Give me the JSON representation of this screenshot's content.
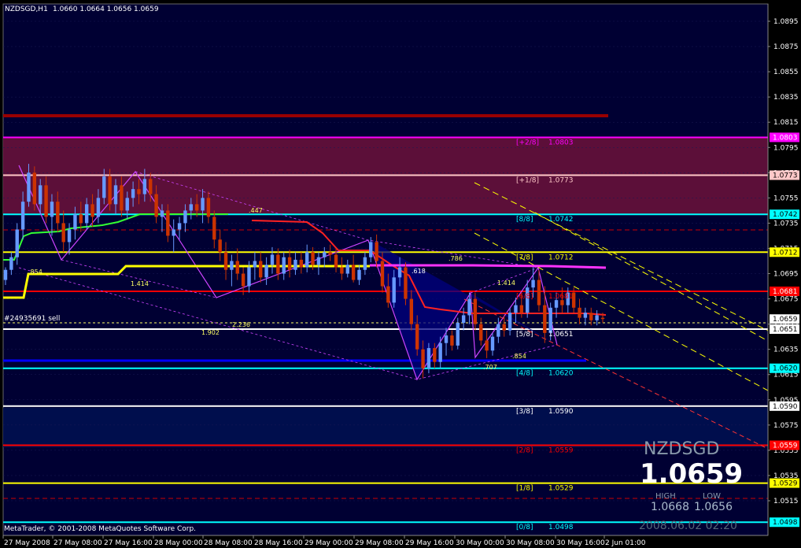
{
  "header": {
    "symbol_tf": "NZDSGD,H1",
    "ohlc": "1.0660 1.0664 1.0656 1.0659"
  },
  "watermark": {
    "symbol": "NZDSGD",
    "price": "1.0659",
    "high_label": "HIGH",
    "low_label": "LOW",
    "high": "1.0668",
    "low": "1.0656",
    "datetime": "2008.06.02 02:20"
  },
  "copyright": "MetaTrader, © 2001-2008 MetaQuotes Software Corp.",
  "order_label": "#24935691 sell",
  "colors": {
    "bg": "#000033",
    "bull": "#6699ff",
    "bear": "#cc3300",
    "grid": "#444444"
  },
  "chart_data": {
    "type": "candlestick",
    "symbol": "NZDSGD",
    "timeframe": "H1",
    "ylim": [
      1.049,
      1.0915
    ],
    "y_ticks": [
      "1.0895",
      "1.0875",
      "1.0855",
      "1.0835",
      "1.0815",
      "1.0795",
      "1.0775",
      "1.0755",
      "1.0735",
      "1.0715",
      "1.0695",
      "1.0675",
      "1.0655",
      "1.0635",
      "1.0615",
      "1.0595",
      "1.0575",
      "1.0555",
      "1.0535",
      "1.0515"
    ],
    "x_ticks": [
      "27 May 2008",
      "27 May 08:00",
      "27 May 16:00",
      "28 May 00:00",
      "28 May 08:00",
      "28 May 16:00",
      "29 May 00:00",
      "29 May 08:00",
      "29 May 16:00",
      "30 May 00:00",
      "30 May 08:00",
      "30 May 16:00",
      "2 Jun 01:00"
    ],
    "price_tags": [
      {
        "value": "1.0803",
        "bg": "#ff00ff",
        "fg": "#ffffff"
      },
      {
        "value": "1.0773",
        "bg": "#ffc8c8",
        "fg": "#000000"
      },
      {
        "value": "1.0742",
        "bg": "#00ffff",
        "fg": "#000000"
      },
      {
        "value": "1.0712",
        "bg": "#ffff00",
        "fg": "#000000"
      },
      {
        "value": "1.0681",
        "bg": "#ff0000",
        "fg": "#ffffff"
      },
      {
        "value": "1.0659",
        "bg": "#ffffff",
        "fg": "#000000"
      },
      {
        "value": "1.0651",
        "bg": "#ffffff",
        "fg": "#000000"
      },
      {
        "value": "1.0620",
        "bg": "#00ffff",
        "fg": "#000000"
      },
      {
        "value": "1.0590",
        "bg": "#ffffff",
        "fg": "#000000"
      },
      {
        "value": "1.0559",
        "bg": "#ff0000",
        "fg": "#ffffff"
      },
      {
        "value": "1.0529",
        "bg": "#ffff00",
        "fg": "#000000"
      },
      {
        "value": "1.0498",
        "bg": "#00ffff",
        "fg": "#000000"
      }
    ],
    "murrey_levels": [
      {
        "label": "[+2/8]",
        "value": "1.0803",
        "price": 1.0803,
        "color": "#ff00ff"
      },
      {
        "label": "[+1/8]",
        "value": "1.0773",
        "price": 1.0773,
        "color": "#ffc8c8"
      },
      {
        "label": "[8/8]",
        "value": "1.0742",
        "price": 1.0742,
        "color": "#00ffff"
      },
      {
        "label": "[7/8]",
        "value": "1.0712",
        "price": 1.0712,
        "color": "#ffff00"
      },
      {
        "label": "[6/8]",
        "value": "1.0681",
        "price": 1.0681,
        "color": "#ff0000"
      },
      {
        "label": "[5/8]",
        "value": "1.0651",
        "price": 1.0651,
        "color": "#ffffff"
      },
      {
        "label": "[4/8]",
        "value": "1.0620",
        "price": 1.062,
        "color": "#00ffff"
      },
      {
        "label": "[3/8]",
        "value": "1.0590",
        "price": 1.059,
        "color": "#ffffff"
      },
      {
        "label": "[2/8]",
        "value": "1.0559",
        "price": 1.0559,
        "color": "#ff0000"
      },
      {
        "label": "[1/8]",
        "value": "1.0529",
        "price": 1.0529,
        "color": "#ffff00"
      },
      {
        "label": "[0/8]",
        "value": "1.0498",
        "price": 1.0498,
        "color": "#00ffff"
      }
    ],
    "fib_labels": [
      ".854",
      "1.414",
      ".447",
      ".786",
      ".618",
      "1.414",
      "2.236",
      "1.902",
      ".707",
      ".854"
    ],
    "candles": [
      {
        "o": 1.069,
        "h": 1.07,
        "l": 1.0686,
        "c": 1.0698
      },
      {
        "o": 1.0698,
        "h": 1.0712,
        "l": 1.0694,
        "c": 1.0708
      },
      {
        "o": 1.0708,
        "h": 1.0735,
        "l": 1.0702,
        "c": 1.073
      },
      {
        "o": 1.073,
        "h": 1.076,
        "l": 1.0722,
        "c": 1.0752
      },
      {
        "o": 1.0752,
        "h": 1.0782,
        "l": 1.0748,
        "c": 1.0775
      },
      {
        "o": 1.0775,
        "h": 1.078,
        "l": 1.0745,
        "c": 1.075
      },
      {
        "o": 1.075,
        "h": 1.077,
        "l": 1.0742,
        "c": 1.0765
      },
      {
        "o": 1.0765,
        "h": 1.0772,
        "l": 1.0735,
        "c": 1.074
      },
      {
        "o": 1.074,
        "h": 1.0758,
        "l": 1.0725,
        "c": 1.0752
      },
      {
        "o": 1.0752,
        "h": 1.076,
        "l": 1.0728,
        "c": 1.0735
      },
      {
        "o": 1.0735,
        "h": 1.0745,
        "l": 1.0712,
        "c": 1.072
      },
      {
        "o": 1.072,
        "h": 1.0735,
        "l": 1.071,
        "c": 1.073
      },
      {
        "o": 1.073,
        "h": 1.0748,
        "l": 1.0722,
        "c": 1.0742
      },
      {
        "o": 1.0742,
        "h": 1.0752,
        "l": 1.0728,
        "c": 1.0735
      },
      {
        "o": 1.0735,
        "h": 1.0755,
        "l": 1.073,
        "c": 1.075
      },
      {
        "o": 1.075,
        "h": 1.0758,
        "l": 1.0732,
        "c": 1.074
      },
      {
        "o": 1.074,
        "h": 1.0762,
        "l": 1.0735,
        "c": 1.0755
      },
      {
        "o": 1.0755,
        "h": 1.0778,
        "l": 1.075,
        "c": 1.0772
      },
      {
        "o": 1.0772,
        "h": 1.0778,
        "l": 1.0745,
        "c": 1.075
      },
      {
        "o": 1.075,
        "h": 1.077,
        "l": 1.0742,
        "c": 1.0765
      },
      {
        "o": 1.0765,
        "h": 1.0772,
        "l": 1.074,
        "c": 1.0745
      },
      {
        "o": 1.0745,
        "h": 1.076,
        "l": 1.0738,
        "c": 1.0755
      },
      {
        "o": 1.0755,
        "h": 1.0768,
        "l": 1.0748,
        "c": 1.0762
      },
      {
        "o": 1.0762,
        "h": 1.077,
        "l": 1.075,
        "c": 1.0758
      },
      {
        "o": 1.0758,
        "h": 1.0778,
        "l": 1.0752,
        "c": 1.077
      },
      {
        "o": 1.077,
        "h": 1.0775,
        "l": 1.0752,
        "c": 1.0758
      },
      {
        "o": 1.0758,
        "h": 1.0765,
        "l": 1.0735,
        "c": 1.074
      },
      {
        "o": 1.074,
        "h": 1.075,
        "l": 1.0728,
        "c": 1.0745
      },
      {
        "o": 1.0745,
        "h": 1.075,
        "l": 1.072,
        "c": 1.0725
      },
      {
        "o": 1.0725,
        "h": 1.0738,
        "l": 1.0712,
        "c": 1.073
      },
      {
        "o": 1.073,
        "h": 1.074,
        "l": 1.0722,
        "c": 1.0735
      },
      {
        "o": 1.0735,
        "h": 1.075,
        "l": 1.0728,
        "c": 1.0745
      },
      {
        "o": 1.0745,
        "h": 1.0755,
        "l": 1.0738,
        "c": 1.075
      },
      {
        "o": 1.075,
        "h": 1.0758,
        "l": 1.074,
        "c": 1.0745
      },
      {
        "o": 1.0745,
        "h": 1.0762,
        "l": 1.0735,
        "c": 1.0755
      },
      {
        "o": 1.0755,
        "h": 1.076,
        "l": 1.0735,
        "c": 1.074
      },
      {
        "o": 1.074,
        "h": 1.0745,
        "l": 1.0715,
        "c": 1.0722
      },
      {
        "o": 1.0722,
        "h": 1.073,
        "l": 1.0705,
        "c": 1.0712
      },
      {
        "o": 1.0712,
        "h": 1.072,
        "l": 1.069,
        "c": 1.0698
      },
      {
        "o": 1.0698,
        "h": 1.071,
        "l": 1.0685,
        "c": 1.0705
      },
      {
        "o": 1.0705,
        "h": 1.0715,
        "l": 1.069,
        "c": 1.0695
      },
      {
        "o": 1.0695,
        "h": 1.07,
        "l": 1.0678,
        "c": 1.0685
      },
      {
        "o": 1.0685,
        "h": 1.0705,
        "l": 1.068,
        "c": 1.07
      },
      {
        "o": 1.07,
        "h": 1.0712,
        "l": 1.069,
        "c": 1.0705
      },
      {
        "o": 1.0705,
        "h": 1.0712,
        "l": 1.0688,
        "c": 1.0692
      },
      {
        "o": 1.0692,
        "h": 1.0708,
        "l": 1.0686,
        "c": 1.0702
      },
      {
        "o": 1.0702,
        "h": 1.0716,
        "l": 1.0695,
        "c": 1.071
      },
      {
        "o": 1.071,
        "h": 1.0715,
        "l": 1.069,
        "c": 1.0695
      },
      {
        "o": 1.0695,
        "h": 1.0712,
        "l": 1.069,
        "c": 1.0708
      },
      {
        "o": 1.0708,
        "h": 1.0714,
        "l": 1.0692,
        "c": 1.0698
      },
      {
        "o": 1.0698,
        "h": 1.0712,
        "l": 1.0694,
        "c": 1.0706
      },
      {
        "o": 1.0706,
        "h": 1.0712,
        "l": 1.0695,
        "c": 1.07
      },
      {
        "o": 1.07,
        "h": 1.0718,
        "l": 1.0696,
        "c": 1.0712
      },
      {
        "o": 1.0712,
        "h": 1.0716,
        "l": 1.0698,
        "c": 1.0702
      },
      {
        "o": 1.0702,
        "h": 1.0712,
        "l": 1.0694,
        "c": 1.0708
      },
      {
        "o": 1.0708,
        "h": 1.0716,
        "l": 1.07,
        "c": 1.0712
      },
      {
        "o": 1.0712,
        "h": 1.0718,
        "l": 1.0705,
        "c": 1.071
      },
      {
        "o": 1.071,
        "h": 1.0715,
        "l": 1.0696,
        "c": 1.07
      },
      {
        "o": 1.07,
        "h": 1.0708,
        "l": 1.069,
        "c": 1.0695
      },
      {
        "o": 1.0695,
        "h": 1.0706,
        "l": 1.0692,
        "c": 1.0702
      },
      {
        "o": 1.0702,
        "h": 1.071,
        "l": 1.0688,
        "c": 1.069
      },
      {
        "o": 1.069,
        "h": 1.0702,
        "l": 1.0686,
        "c": 1.0698
      },
      {
        "o": 1.0698,
        "h": 1.0712,
        "l": 1.0694,
        "c": 1.0708
      },
      {
        "o": 1.0708,
        "h": 1.0724,
        "l": 1.0704,
        "c": 1.072
      },
      {
        "o": 1.072,
        "h": 1.0726,
        "l": 1.07,
        "c": 1.0705
      },
      {
        "o": 1.0705,
        "h": 1.0712,
        "l": 1.068,
        "c": 1.0685
      },
      {
        "o": 1.0685,
        "h": 1.0695,
        "l": 1.0668,
        "c": 1.0672
      },
      {
        "o": 1.0672,
        "h": 1.0698,
        "l": 1.0668,
        "c": 1.0692
      },
      {
        "o": 1.0692,
        "h": 1.0708,
        "l": 1.0685,
        "c": 1.07
      },
      {
        "o": 1.07,
        "h": 1.0704,
        "l": 1.067,
        "c": 1.0675
      },
      {
        "o": 1.0675,
        "h": 1.0682,
        "l": 1.065,
        "c": 1.0655
      },
      {
        "o": 1.0655,
        "h": 1.0662,
        "l": 1.063,
        "c": 1.0635
      },
      {
        "o": 1.0635,
        "h": 1.0642,
        "l": 1.0612,
        "c": 1.062
      },
      {
        "o": 1.062,
        "h": 1.064,
        "l": 1.0616,
        "c": 1.0636
      },
      {
        "o": 1.0636,
        "h": 1.064,
        "l": 1.062,
        "c": 1.0625
      },
      {
        "o": 1.0625,
        "h": 1.0645,
        "l": 1.062,
        "c": 1.064
      },
      {
        "o": 1.064,
        "h": 1.0652,
        "l": 1.063,
        "c": 1.0646
      },
      {
        "o": 1.0646,
        "h": 1.065,
        "l": 1.0634,
        "c": 1.0638
      },
      {
        "o": 1.0638,
        "h": 1.066,
        "l": 1.0635,
        "c": 1.0656
      },
      {
        "o": 1.0656,
        "h": 1.0668,
        "l": 1.065,
        "c": 1.0662
      },
      {
        "o": 1.0662,
        "h": 1.068,
        "l": 1.0655,
        "c": 1.0675
      },
      {
        "o": 1.0675,
        "h": 1.068,
        "l": 1.065,
        "c": 1.0655
      },
      {
        "o": 1.0655,
        "h": 1.066,
        "l": 1.0638,
        "c": 1.0642
      },
      {
        "o": 1.0642,
        "h": 1.065,
        "l": 1.0628,
        "c": 1.0634
      },
      {
        "o": 1.0634,
        "h": 1.0648,
        "l": 1.063,
        "c": 1.0645
      },
      {
        "o": 1.0645,
        "h": 1.066,
        "l": 1.064,
        "c": 1.0655
      },
      {
        "o": 1.0655,
        "h": 1.0662,
        "l": 1.0645,
        "c": 1.065
      },
      {
        "o": 1.065,
        "h": 1.0668,
        "l": 1.0646,
        "c": 1.0664
      },
      {
        "o": 1.0664,
        "h": 1.0676,
        "l": 1.0656,
        "c": 1.067
      },
      {
        "o": 1.067,
        "h": 1.068,
        "l": 1.066,
        "c": 1.0664
      },
      {
        "o": 1.0664,
        "h": 1.069,
        "l": 1.066,
        "c": 1.0684
      },
      {
        "o": 1.0684,
        "h": 1.07,
        "l": 1.0676,
        "c": 1.069
      },
      {
        "o": 1.069,
        "h": 1.0698,
        "l": 1.0665,
        "c": 1.067
      },
      {
        "o": 1.067,
        "h": 1.0685,
        "l": 1.064,
        "c": 1.0648
      },
      {
        "o": 1.0648,
        "h": 1.0672,
        "l": 1.0642,
        "c": 1.0668
      },
      {
        "o": 1.0668,
        "h": 1.068,
        "l": 1.066,
        "c": 1.0674
      },
      {
        "o": 1.0674,
        "h": 1.0684,
        "l": 1.0664,
        "c": 1.067
      },
      {
        "o": 1.067,
        "h": 1.0684,
        "l": 1.0664,
        "c": 1.068
      },
      {
        "o": 1.068,
        "h": 1.0684,
        "l": 1.0664,
        "c": 1.0668
      },
      {
        "o": 1.0668,
        "h": 1.0675,
        "l": 1.0655,
        "c": 1.066
      },
      {
        "o": 1.066,
        "h": 1.0668,
        "l": 1.0654,
        "c": 1.0664
      },
      {
        "o": 1.0664,
        "h": 1.0668,
        "l": 1.0654,
        "c": 1.0658
      },
      {
        "o": 1.0658,
        "h": 1.0666,
        "l": 1.0654,
        "c": 1.0662
      },
      {
        "o": 1.066,
        "h": 1.0664,
        "l": 1.0656,
        "c": 1.0659
      }
    ]
  }
}
